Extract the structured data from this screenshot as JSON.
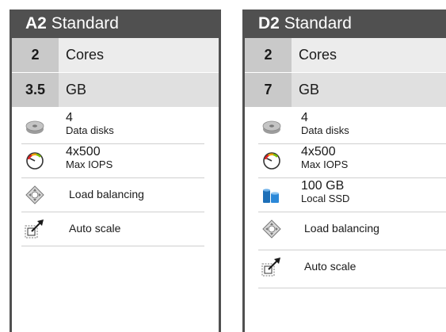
{
  "cards": [
    {
      "series": "A2",
      "tier": "Standard",
      "cores_value": "2",
      "cores_label": "Cores",
      "memory_value": "3.5",
      "memory_label": "GB",
      "features": {
        "data_disks_value": "4",
        "data_disks_label": "Data disks",
        "iops_value": "4x500",
        "iops_label": "Max IOPS",
        "load_balancing": "Load balancing",
        "auto_scale": "Auto scale"
      }
    },
    {
      "series": "D2",
      "tier": "Standard",
      "cores_value": "2",
      "cores_label": "Cores",
      "memory_value": "7",
      "memory_label": "GB",
      "features": {
        "data_disks_value": "4",
        "data_disks_label": "Data disks",
        "iops_value": "4x500",
        "iops_label": "Max IOPS",
        "ssd_value": "100 GB",
        "ssd_label": "Local SSD",
        "load_balancing": "Load balancing",
        "auto_scale": "Auto scale"
      }
    }
  ],
  "icons": {
    "disk": "disk-icon",
    "gauge": "gauge-icon",
    "ssd": "ssd-icon",
    "balancer": "load-balancer-icon",
    "scale": "auto-scale-icon"
  },
  "colors": {
    "header_bg": "#505050",
    "number_bg": "#c9c9c9",
    "row_bg": "#ececec",
    "ssd_blue": "#1d6fb8"
  }
}
